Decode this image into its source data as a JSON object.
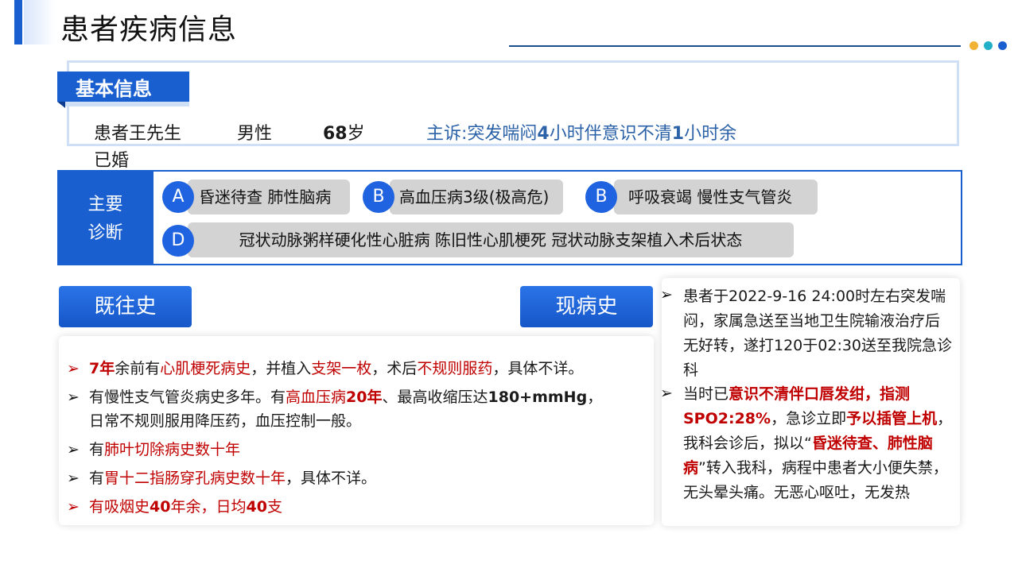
{
  "header": {
    "title": "患者疾病信息"
  },
  "basic_info": {
    "tab_label": "基本信息",
    "name": "患者王先生",
    "gender": "男性",
    "age_num": "68",
    "age_unit": "岁",
    "marital": "已婚",
    "complaint_prefix": "主诉:突发喘闷",
    "complaint_n1": "4",
    "complaint_mid": "小时伴意识不清",
    "complaint_n2": "1",
    "complaint_suffix": "小时余"
  },
  "diagnosis": {
    "label_line1": "主要",
    "label_line2": "诊断",
    "items": [
      {
        "badge": "A",
        "text": "昏迷待查 肺性脑病"
      },
      {
        "badge": "B",
        "text": "高血压病3级(极高危)"
      },
      {
        "badge": "B",
        "text": "呼吸衰竭 慢性支气管炎"
      },
      {
        "badge": "D",
        "text": "冠状动脉粥样硬化性心脏病 陈旧性心肌梗死 冠状动脉支架植入术后状态"
      }
    ]
  },
  "past_history": {
    "button_label": "既往史",
    "bullet": "➢",
    "item1": {
      "a": "7年",
      "b": "余前有",
      "c": "心肌梗死病史",
      "d": "，并植入",
      "e": "支架一枚",
      "f": "，术后",
      "g": "不规则服药",
      "h": "，具体不详。"
    },
    "item2": {
      "a": "有慢性支气管炎病史多年。有",
      "b": "高血压病",
      "c": "20年",
      "d": "、最高收缩压达",
      "e": "180+mmHg",
      "f": "，",
      "g": "日常不规则服用降压药，血压控制一般。"
    },
    "item3": {
      "a": "有",
      "b": "肺叶切除病史数十年"
    },
    "item4": {
      "a": "有",
      "b": "胃十二指肠穿孔病史数十年",
      "c": "，具体不详。"
    },
    "item5": {
      "a": "有吸烟史",
      "b": "40",
      "c": "年余，日均",
      "d": "40",
      "e": "支"
    }
  },
  "present_history": {
    "button_label": "现病史",
    "bullet": "➢",
    "p1": "患者于2022-9-16 24:00时左右突发喘闷，家属急送至当地卫生院输液治疗后无好转，遂打120于02:30送至我院急诊科",
    "p2a": "当时已",
    "p2b": "意识不清伴口唇发绀，指测SPO2:28%",
    "p2c": "，急诊立即",
    "p2d": "予以插管上机",
    "p2e": "，我科会诊后，拟以“",
    "p2f": "昏迷待查、肺性脑病",
    "p2g": "”转入我科，病程中患者大小便失禁，无头晕头痛。无恶心呕吐，无发热"
  },
  "colors": {
    "primary_blue": "#1a5fd0",
    "accent_red": "#c00000",
    "complaint_blue": "#2b62a8"
  }
}
